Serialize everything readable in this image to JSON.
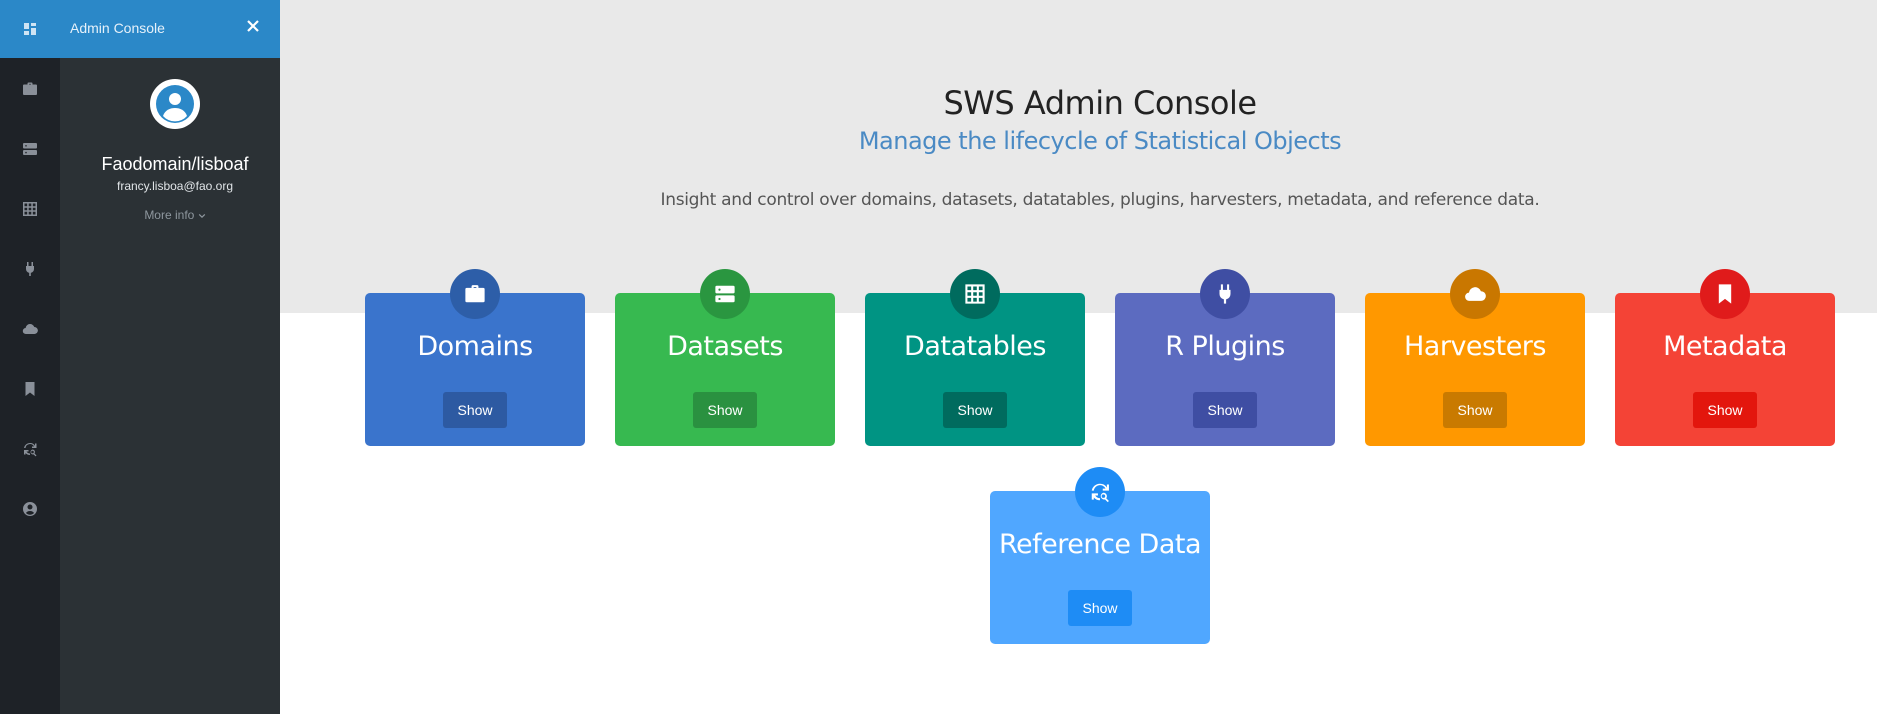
{
  "sidebar": {
    "title": "Admin Console",
    "user_name": "Faodomain/lisboaf",
    "user_email": "francy.lisboa@fao.org",
    "more_info": "More info"
  },
  "rail_icons": [
    "dashboard-icon",
    "briefcase-icon",
    "server-icon",
    "grid-icon",
    "plug-icon",
    "cloud-icon",
    "bookmark-icon",
    "refresh-search-icon",
    "user-circle-icon"
  ],
  "main": {
    "title": "SWS Admin Console",
    "subtitle": "Manage the lifecycle of Statistical Objects",
    "description": "Insight and control over domains, datasets, datatables, plugins, harvesters, metadata, and reference data."
  },
  "cards": [
    {
      "title": "Domains",
      "button": "Show",
      "icon": "briefcase-icon",
      "color": "#3a74cc",
      "badge_color": "#2d5ea8",
      "button_color": "#2d5aa2"
    },
    {
      "title": "Datasets",
      "button": "Show",
      "icon": "server-icon",
      "color": "#37b950",
      "badge_color": "#2a9640",
      "button_color": "#2a9140"
    },
    {
      "title": "Datatables",
      "button": "Show",
      "icon": "grid-icon",
      "color": "#009483",
      "badge_color": "#006b5e",
      "button_color": "#006b5e"
    },
    {
      "title": "R Plugins",
      "button": "Show",
      "icon": "plug-icon",
      "color": "#5c6bc0",
      "badge_color": "#3f4ea3",
      "button_color": "#3f4ea3"
    },
    {
      "title": "Harvesters",
      "button": "Show",
      "icon": "cloud-icon",
      "color": "#ff9800",
      "badge_color": "#c97700",
      "button_color": "#c97a00"
    },
    {
      "title": "Metadata",
      "button": "Show",
      "icon": "bookmark-icon",
      "color": "#f44336",
      "badge_color": "#e01b1b",
      "button_color": "#e3160d"
    },
    {
      "title": "Reference Data",
      "button": "Show",
      "icon": "refresh-search-icon",
      "color": "#50a7ff",
      "badge_color": "#1e8cf5",
      "button_color": "#1e8cf5"
    }
  ]
}
